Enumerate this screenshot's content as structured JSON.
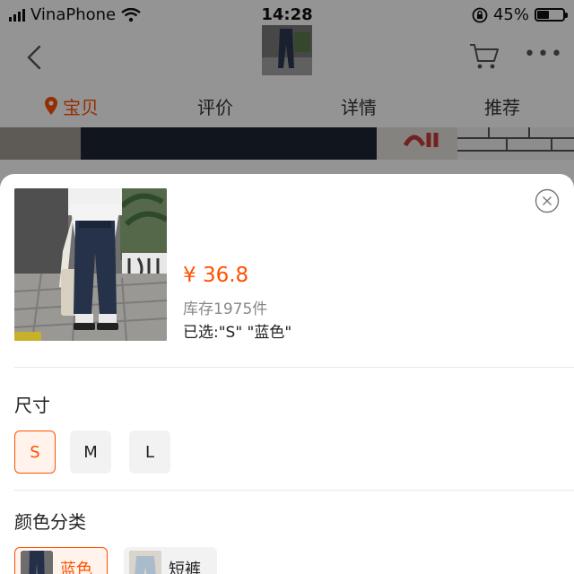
{
  "statusbar": {
    "carrier": "VinaPhone",
    "time": "14:28",
    "battery_text": "45%",
    "battery_level": 0.45
  },
  "navbar": {
    "back_icon": "chevron-left-icon",
    "cart_icon": "cart-icon",
    "more_icon": "more-icon"
  },
  "tabs": [
    {
      "label": "宝贝",
      "active": true
    },
    {
      "label": "评价",
      "active": false
    },
    {
      "label": "详情",
      "active": false
    },
    {
      "label": "推荐",
      "active": false
    }
  ],
  "sku": {
    "price": "¥ 36.8",
    "stock": "库存1975件",
    "selected": "已选:\"S\" \"蓝色\""
  },
  "size": {
    "title": "尺寸",
    "options": [
      {
        "label": "S",
        "selected": true
      },
      {
        "label": "M",
        "selected": false
      },
      {
        "label": "L",
        "selected": false
      }
    ]
  },
  "color": {
    "title": "颜色分类",
    "options": [
      {
        "label": "蓝色",
        "selected": true
      },
      {
        "label": "短裤",
        "selected": false
      }
    ]
  },
  "colors": {
    "accent": "#ff5000",
    "accent_bg": "#fff3ec"
  }
}
